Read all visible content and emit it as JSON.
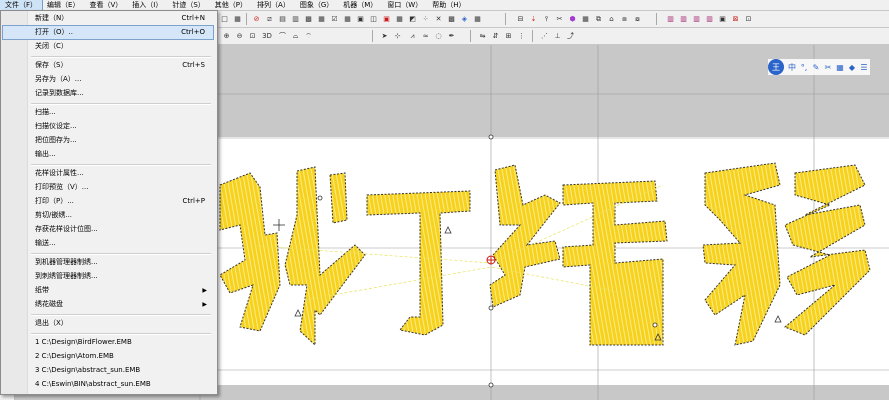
{
  "menubar": [
    {
      "label": "文件（F）"
    },
    {
      "label": "编辑（E）"
    },
    {
      "label": "查看（V）"
    },
    {
      "label": "插入（I）"
    },
    {
      "label": "针迹（S）"
    },
    {
      "label": "其他（P）"
    },
    {
      "label": "排列（A）"
    },
    {
      "label": "图象（G）"
    },
    {
      "label": "机器（M）"
    },
    {
      "label": "窗口（W）"
    },
    {
      "label": "帮助（H）"
    }
  ],
  "file_menu": {
    "new": {
      "label": "新建（N）",
      "shortcut": "Ctrl+N"
    },
    "open": {
      "label": "打开（O）..",
      "shortcut": "Ctrl+O"
    },
    "close": {
      "label": "关闭（C）"
    },
    "save": {
      "label": "保存（S）",
      "shortcut": "Ctrl+S"
    },
    "save_as": {
      "label": "另存为（A）..."
    },
    "save_db": {
      "label": "记录到数据库..."
    },
    "scan": {
      "label": "扫描..."
    },
    "scanner_setup": {
      "label": "扫描仪设定..."
    },
    "save_picture": {
      "label": "把位图存为..."
    },
    "output": {
      "label": "输出..."
    },
    "design_props": {
      "label": "花样设计属性..."
    },
    "print_preview": {
      "label": "打印预览（V）..."
    },
    "print": {
      "label": "打印（P）...",
      "shortcut": "Ctrl+P"
    },
    "cut_embroider": {
      "label": "剪切/嵌绣..."
    },
    "save_design_pos": {
      "label": "存获花样设计位图..."
    },
    "transmit": {
      "label": "输送..."
    },
    "to_machine_mgr": {
      "label": "到机器管理器制绣..."
    },
    "to_embroider_mgr": {
      "label": "到刺绣管理器制绣..."
    },
    "tape": {
      "label": "纸带"
    },
    "floppy": {
      "label": "绣花磁盘"
    },
    "exit": {
      "label": "退出（X）"
    },
    "recent": [
      "1 C:\\Design\\BirdFlower.EMB",
      "2 C:\\Design\\Atom.EMB",
      "3 C:\\Design\\abstract_sun.EMB",
      "4 C:\\Eswin\\BIN\\abstract_sun.EMB"
    ]
  },
  "toolbar2": {
    "zoom_3d": "3D"
  },
  "ime": {
    "logo": "王",
    "mode": "中"
  },
  "design_text": {
    "chars": [
      "张",
      "灯",
      "结",
      "彩"
    ]
  },
  "colors": {
    "fill": "#f7d21d",
    "stitch": "#fdf1a6",
    "outline": "#333333",
    "accent": "#cc1a1a",
    "highlight": "#d5e6f8"
  }
}
